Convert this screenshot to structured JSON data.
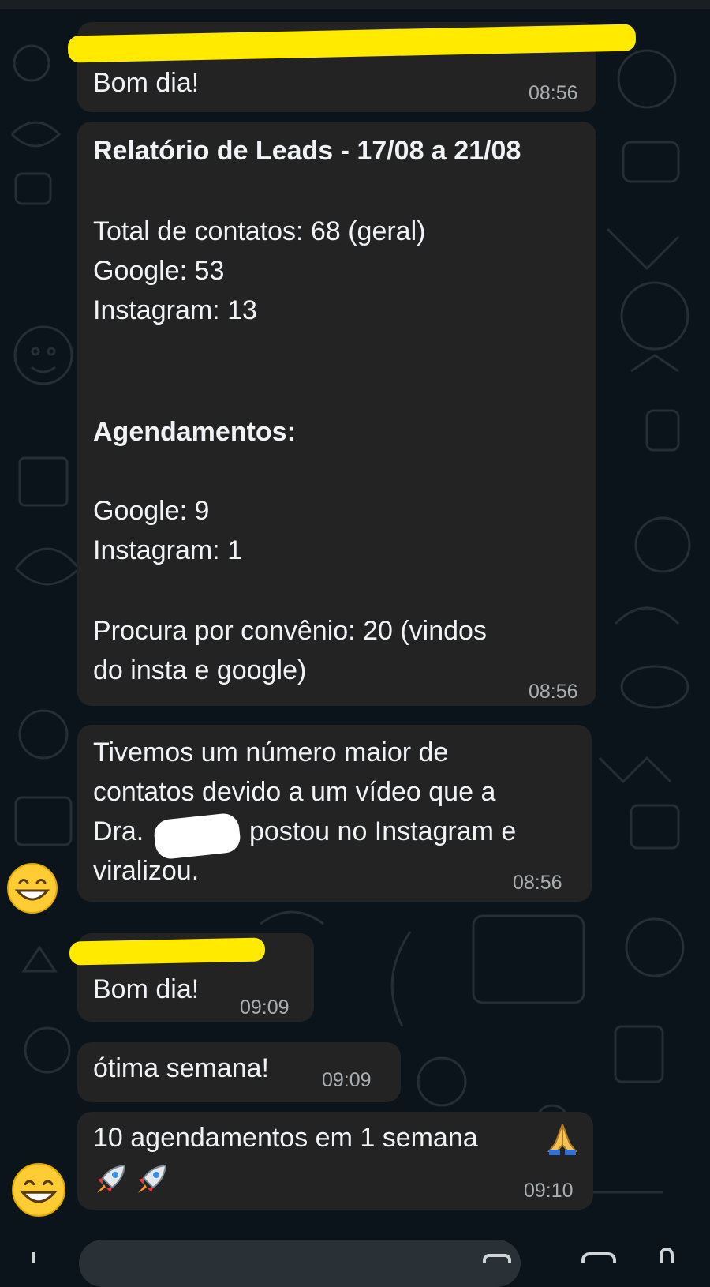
{
  "messages": [
    {
      "text": [
        "Bom dia!"
      ],
      "time": "08:56"
    },
    {
      "title": "Relatório de Leads - 17/08 a 21/08",
      "lines": [
        "Total de contatos: 68 (geral)",
        "Google: 53",
        "Instagram: 13"
      ],
      "subtitle": "Agendamentos:",
      "lines2": [
        "Google: 9",
        "Instagram: 1"
      ],
      "lines3": [
        "Procura por convênio: 20 (vindos",
        "do insta e google)"
      ],
      "time": "08:56"
    },
    {
      "text": [
        "Tivemos um número maior de",
        "contatos devido a um vídeo que a",
        "Dra.",
        "postou no Instagram e",
        "viralizou."
      ],
      "time": "08:56",
      "reaction": "grinning-face"
    },
    {
      "text": [
        "Bom dia!"
      ],
      "time": "09:09"
    },
    {
      "text": [
        "ótima semana!"
      ],
      "time": "09:09"
    },
    {
      "text": [
        "10 agendamentos em 1 semana"
      ],
      "time": "09:10",
      "emojis": [
        "folded-hands",
        "rocket",
        "rocket"
      ],
      "reaction": "grinning-face"
    }
  ],
  "colors": {
    "background": "#0b141a",
    "bubble": "#232323",
    "highlight": "#ffea00",
    "timestamp": "#a8aeb1"
  }
}
